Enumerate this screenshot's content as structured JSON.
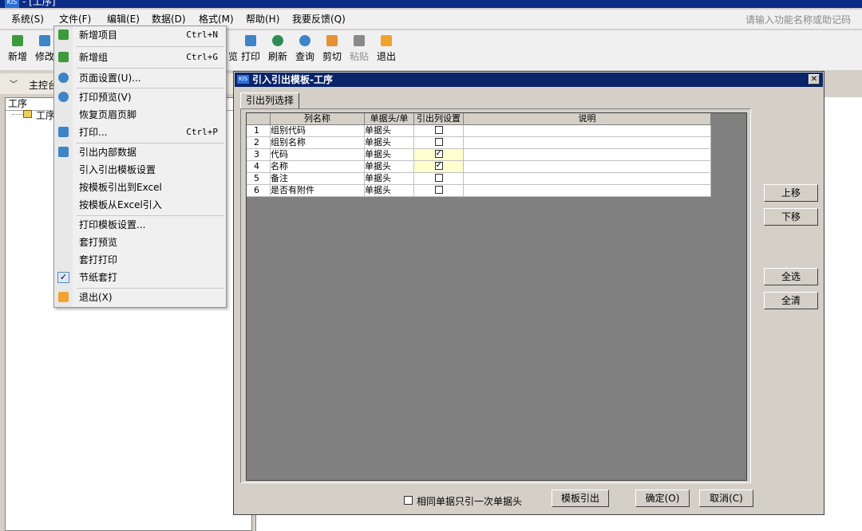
{
  "window": {
    "logo": "KIS",
    "title": "- [工序]"
  },
  "menubar": {
    "items": [
      "系统(S)",
      "文件(F)",
      "编辑(E)",
      "数据(D)",
      "格式(M)",
      "帮助(H)",
      "我要反馈(Q)"
    ],
    "search_placeholder": "请输入功能名称或助记码"
  },
  "toolbar": {
    "buttons": [
      "新增",
      "修改",
      "预览",
      "打印",
      "刷新",
      "查询",
      "剪切",
      "粘贴",
      "退出"
    ]
  },
  "tabs": {
    "main": "主控台"
  },
  "tree": {
    "header": "工序",
    "root": "工序"
  },
  "file_menu": {
    "items": [
      {
        "label": "新增项目",
        "shortcut": "Ctrl+N",
        "icon": "add-icon"
      },
      {
        "label": "新增组",
        "shortcut": "Ctrl+G",
        "icon": "add-group-icon"
      },
      {
        "label": "页面设置(U)...",
        "icon": "gear-icon"
      },
      {
        "label": "打印预览(V)",
        "icon": "preview-icon"
      },
      {
        "label": "恢复页眉页脚"
      },
      {
        "label": "打印...",
        "shortcut": "Ctrl+P",
        "icon": "print-icon"
      },
      {
        "label": "引出内部数据",
        "icon": "export-icon"
      },
      {
        "label": "引入引出模板设置"
      },
      {
        "label": "按模板引出到Excel"
      },
      {
        "label": "按模板从Excel引入"
      },
      {
        "label": "打印模板设置..."
      },
      {
        "label": "套打预览"
      },
      {
        "label": "套打打印"
      },
      {
        "label": "节纸套打",
        "checked": true
      },
      {
        "label": "退出(X)",
        "icon": "exit-icon"
      }
    ]
  },
  "dialog": {
    "logo": "KIS",
    "title": "引入引出模板-工序",
    "tab": "引出列选择",
    "columns": [
      "列名称",
      "单据头/单",
      "引出列设置",
      "说明"
    ],
    "rows": [
      {
        "no": "1",
        "name": "组别代码",
        "type": "单据头",
        "export": false
      },
      {
        "no": "2",
        "name": "组别名称",
        "type": "单据头",
        "export": false
      },
      {
        "no": "3",
        "name": "代码",
        "type": "单据头",
        "export": true
      },
      {
        "no": "4",
        "name": "名称",
        "type": "单据头",
        "export": true
      },
      {
        "no": "5",
        "name": "备注",
        "type": "单据头",
        "export": false
      },
      {
        "no": "6",
        "name": "是否有附件",
        "type": "单据头",
        "export": false
      }
    ],
    "side_buttons": {
      "up": "上移",
      "down": "下移",
      "select_all": "全选",
      "clear_all": "全清"
    },
    "footer": {
      "same_bill_check": "相同单据只引一次单据头",
      "template_export": "模板引出",
      "ok": "确定(O)",
      "cancel": "取消(C)"
    }
  },
  "colors": {
    "accent": "#e53935",
    "title_bar": "#0a246a",
    "check_fill": "#ffffd0"
  }
}
